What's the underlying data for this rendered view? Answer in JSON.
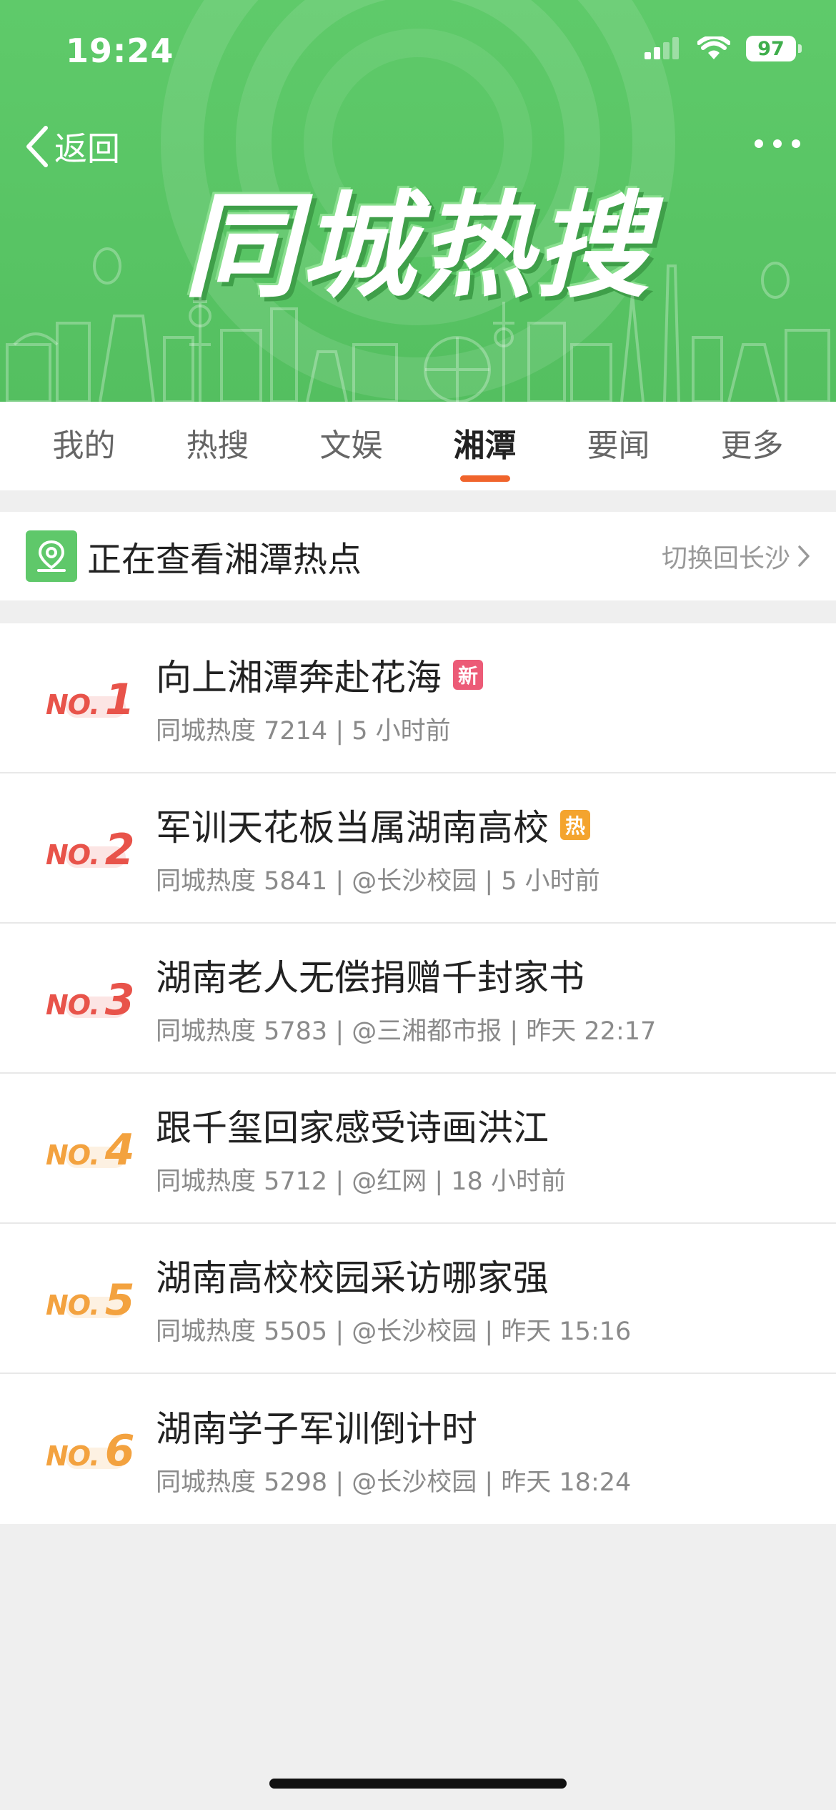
{
  "status_bar": {
    "time": "19:24",
    "battery": "97"
  },
  "header": {
    "back_label": "返回",
    "banner_title": "同城热搜",
    "brand_color": "#5bc666"
  },
  "tabs": [
    {
      "label": "我的",
      "active": false
    },
    {
      "label": "热搜",
      "active": false
    },
    {
      "label": "文娱",
      "active": false
    },
    {
      "label": "湘潭",
      "active": true
    },
    {
      "label": "要闻",
      "active": false
    },
    {
      "label": "更多",
      "active": false
    }
  ],
  "location_bar": {
    "icon": "map-pin-icon",
    "text": "正在查看湘潭热点",
    "switch_label": "切换回长沙"
  },
  "hot_list": [
    {
      "rank_prefix": "NO.",
      "rank": "1",
      "title": "向上湘潭奔赴花海",
      "badge": "新",
      "badge_color": "#ec5b77",
      "meta": "同城热度 7214 | 5 小时前",
      "rank_color": "#e8534a"
    },
    {
      "rank_prefix": "NO.",
      "rank": "2",
      "title": "军训天花板当属湖南高校",
      "badge": "热",
      "badge_color": "#f4a42e",
      "meta": "同城热度 5841 | @长沙校园 | 5 小时前",
      "rank_color": "#e8534a"
    },
    {
      "rank_prefix": "NO.",
      "rank": "3",
      "title": "湖南老人无偿捐赠千封家书",
      "badge": "",
      "badge_color": "",
      "meta": "同城热度 5783 | @三湘都市报 | 昨天 22:17",
      "rank_color": "#e8534a"
    },
    {
      "rank_prefix": "NO.",
      "rank": "4",
      "title": "跟千玺回家感受诗画洪江",
      "badge": "",
      "badge_color": "",
      "meta": "同城热度 5712 | @红网 | 18 小时前",
      "rank_color": "#f3a23f"
    },
    {
      "rank_prefix": "NO.",
      "rank": "5",
      "title": "湖南高校校园采访哪家强",
      "badge": "",
      "badge_color": "",
      "meta": "同城热度 5505 | @长沙校园 | 昨天 15:16",
      "rank_color": "#f3a23f"
    },
    {
      "rank_prefix": "NO.",
      "rank": "6",
      "title": "湖南学子军训倒计时",
      "badge": "",
      "badge_color": "",
      "meta": "同城热度 5298 | @长沙校园 | 昨天 18:24",
      "rank_color": "#f3a23f"
    }
  ]
}
